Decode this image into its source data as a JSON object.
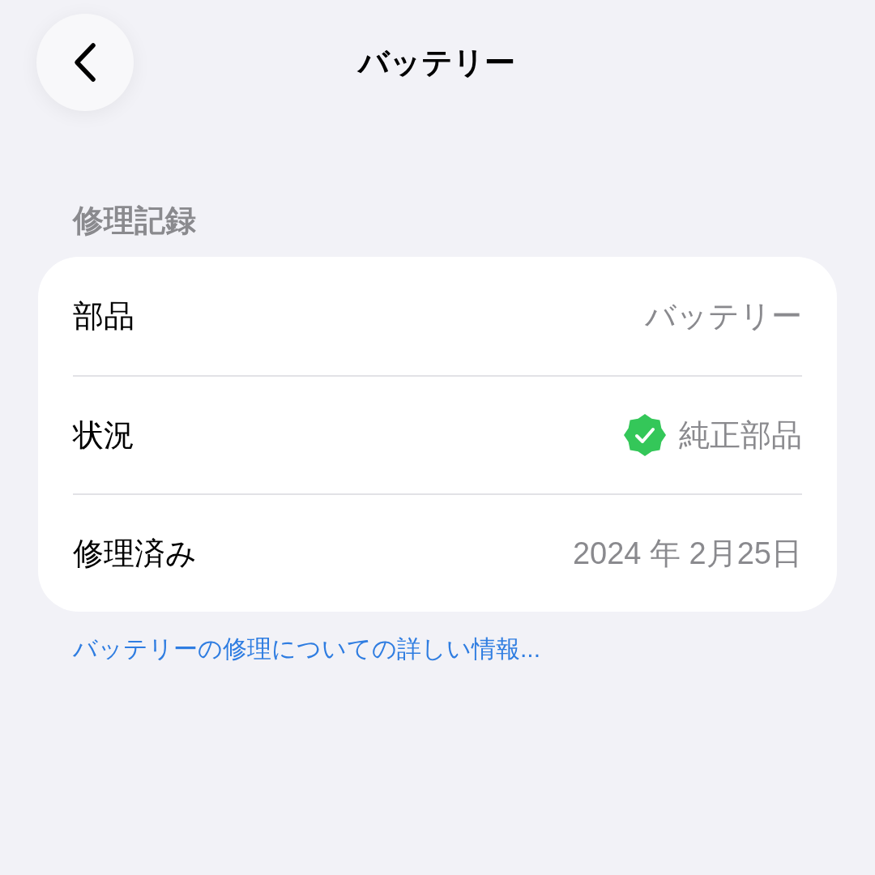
{
  "nav": {
    "title": "バッテリー"
  },
  "section": {
    "header": "修理記録",
    "rows": [
      {
        "label": "部品",
        "value": "バッテリー",
        "kind": "text"
      },
      {
        "label": "状況",
        "value": "純正部品",
        "kind": "verified"
      },
      {
        "label": "修理済み",
        "value": "2024 年 2月25日",
        "kind": "text"
      }
    ],
    "footer_link": "バッテリーの修理についての詳しい情報..."
  }
}
